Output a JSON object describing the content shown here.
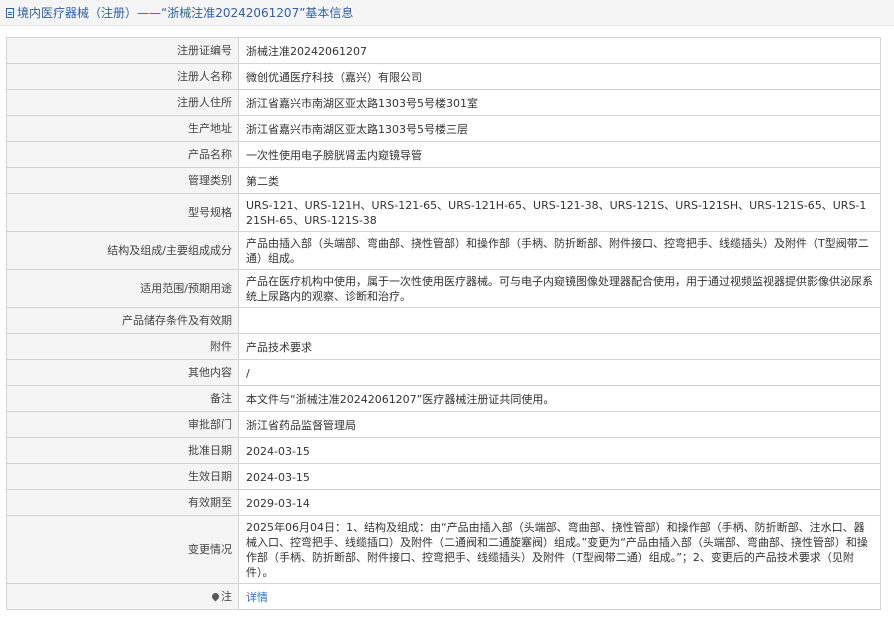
{
  "header": {
    "title": "境内医疗器械（注册）——“浙械注准20242061207”基本信息"
  },
  "rows": [
    {
      "label": "注册证编号",
      "value": "浙械注准20242061207"
    },
    {
      "label": "注册人名称",
      "value": "微创优通医疗科技（嘉兴）有限公司"
    },
    {
      "label": "注册人住所",
      "value": "浙江省嘉兴市南湖区亚太路1303号5号楼301室"
    },
    {
      "label": "生产地址",
      "value": "浙江省嘉兴市南湖区亚太路1303号5号楼三层"
    },
    {
      "label": "产品名称",
      "value": "一次性使用电子膀胱肾盂内窥镜导管"
    },
    {
      "label": "管理类别",
      "value": "第二类"
    },
    {
      "label": "型号规格",
      "value": "URS-121、URS-121H、URS-121-65、URS-121H-65、URS-121-38、URS-121S、URS-121SH、URS-121S-65、URS-121SH-65、URS-121S-38"
    },
    {
      "label": "结构及组成/主要组成成分",
      "value": "产品由插入部（头端部、弯曲部、挠性管部）和操作部（手柄、防折断部、附件接口、控弯把手、线缆插头）及附件（T型阀带二通）组成。"
    },
    {
      "label": "适用范围/预期用途",
      "value": "产品在医疗机构中使用，属于一次性使用医疗器械。可与电子内窥镜图像处理器配合使用，用于通过视频监视器提供影像供泌尿系统上尿路内的观察、诊断和治疗。"
    },
    {
      "label": "产品储存条件及有效期",
      "value": ""
    },
    {
      "label": "附件",
      "value": "产品技术要求"
    },
    {
      "label": "其他内容",
      "value": "/"
    },
    {
      "label": "备注",
      "value": "本文件与“浙械注准20242061207”医疗器械注册证共同使用。"
    },
    {
      "label": "审批部门",
      "value": "浙江省药品监督管理局"
    },
    {
      "label": "批准日期",
      "value": "2024-03-15"
    },
    {
      "label": "生效日期",
      "value": "2024-03-15"
    },
    {
      "label": "有效期至",
      "value": "2029-03-14"
    },
    {
      "label": "变更情况",
      "value": "2025年06月04日：1、结构及组成：由“产品由插入部（头端部、弯曲部、挠性管部）和操作部（手柄、防折断部、注水口、器械入口、控弯把手、线缆插口）及附件（二通阀和二通旋塞阀）组成。”变更为“产品由插入部（头端部、弯曲部、挠性管部）和操作部（手柄、防折断部、附件接口、控弯把手、线缆插头）及附件（T型阀带二通）组成。”；2、变更后的产品技术要求（见附件）。"
    }
  ],
  "note_row": {
    "label": "注",
    "link": "详情",
    "icon": "pin-icon"
  }
}
